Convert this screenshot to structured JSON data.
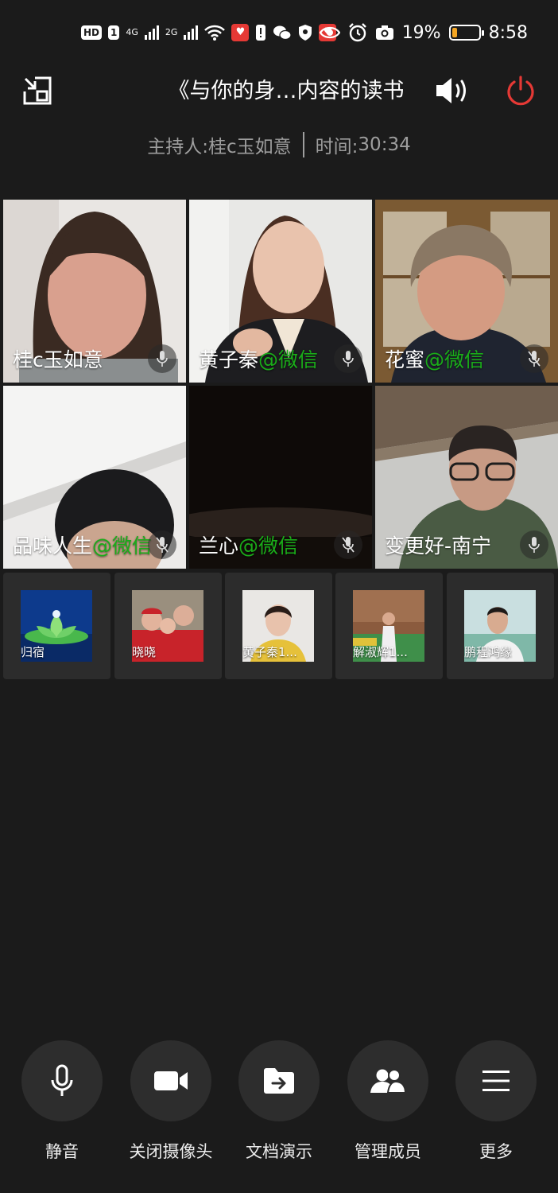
{
  "status_bar": {
    "hd_badge": "HD",
    "sim": "1",
    "net1": "4G",
    "net2": "2G",
    "battery_text": "19%",
    "battery_level": 0.19,
    "time": "8:58"
  },
  "header": {
    "title": "《与你的身…内容的读书",
    "host_label": "主持人:",
    "host_name": "桂c玉如意",
    "time_label": "时间:",
    "time_value": "30:34"
  },
  "video_tiles": [
    {
      "name": "桂c玉如意",
      "suffix": ""
    },
    {
      "name": "黄子秦",
      "suffix": "@微信"
    },
    {
      "name": "花蜜",
      "suffix": "@微信"
    },
    {
      "name": "品味人生",
      "suffix": "@微信"
    },
    {
      "name": "兰心",
      "suffix": "@微信"
    },
    {
      "name": "变更好-南宁",
      "suffix": ""
    }
  ],
  "thumbnails": [
    {
      "name": "归宿"
    },
    {
      "name": "晓晓"
    },
    {
      "name": "黄子秦1..."
    },
    {
      "name": "解淑辉1..."
    },
    {
      "name": "鹏程鸿缘"
    }
  ],
  "controls": [
    {
      "label": "静音",
      "icon": "microphone-icon"
    },
    {
      "label": "关闭摄像头",
      "icon": "video-camera-icon"
    },
    {
      "label": "文档演示",
      "icon": "share-folder-icon"
    },
    {
      "label": "管理成员",
      "icon": "members-icon"
    },
    {
      "label": "更多",
      "icon": "menu-icon"
    }
  ],
  "colors": {
    "background": "#1b1b1b",
    "wechat_green": "#1aad19",
    "power_red": "#e53935",
    "battery_orange": "#f5a623"
  }
}
